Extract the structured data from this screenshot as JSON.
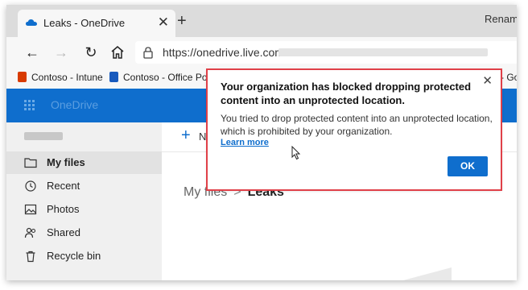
{
  "browser": {
    "tab": {
      "title": "Leaks - OneDrive",
      "close_glyph": "✕"
    },
    "new_tab_glyph": "+",
    "url_text": "https://onedrive.live.com/?id=/",
    "favorites": [
      {
        "label": "Contoso - Intune",
        "icon": "office-icon",
        "color": "#d83b01"
      },
      {
        "label": "Contoso - Office Po...",
        "icon": "word-icon",
        "color": "#185abd"
      },
      {
        "label": "» - Go",
        "icon": "",
        "color": "#222222"
      }
    ]
  },
  "onedrive": {
    "brand": "OneDrive",
    "sidebar": [
      {
        "label": "My files",
        "icon": "folder-icon",
        "active": true
      },
      {
        "label": "Recent",
        "icon": "recent-icon"
      },
      {
        "label": "Photos",
        "icon": "photo-icon"
      },
      {
        "label": "Shared",
        "icon": "people-icon"
      },
      {
        "label": "Recycle bin",
        "icon": "recycle-bin-icon"
      }
    ],
    "command": {
      "new_label": "N",
      "rename_label": "Renam"
    },
    "breadcrumb": {
      "parent": "My files",
      "separator": ">",
      "current": "Leaks"
    }
  },
  "dialog": {
    "title": "Your organization has blocked dropping protected content into an unprotected location.",
    "message": "You tried to drop protected content into an unprotected location, which is prohibited by your organization.",
    "link": "Learn more",
    "ok_button": "OK",
    "close_glyph": "✕"
  },
  "colors": {
    "accent": "#0f6ecd",
    "highlight_border": "#e04048"
  }
}
